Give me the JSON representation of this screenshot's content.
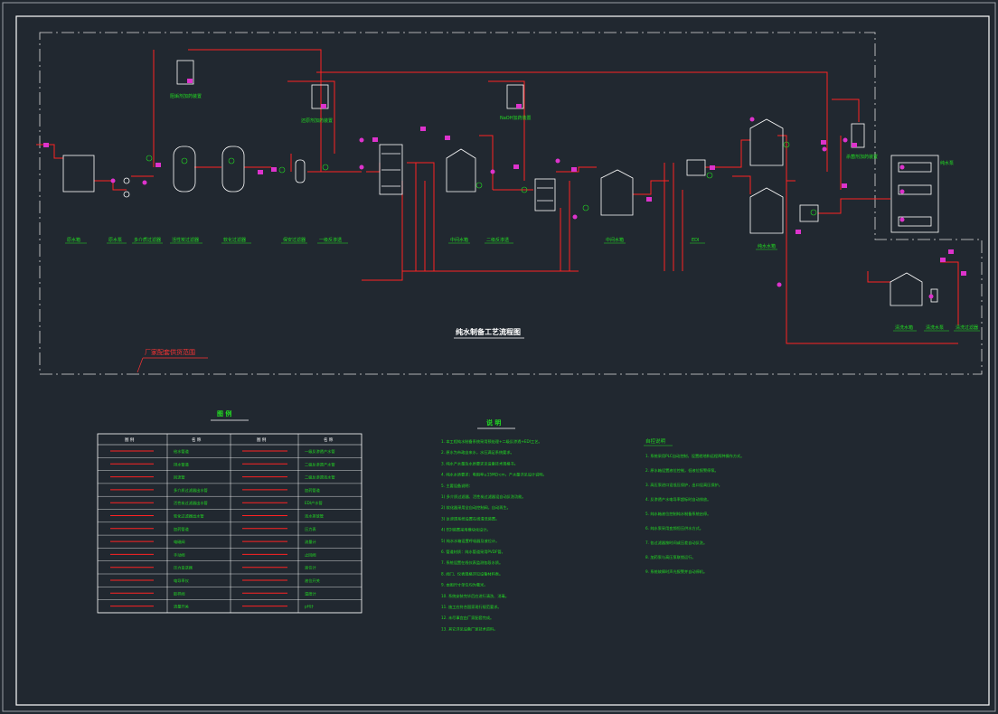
{
  "drawing": {
    "title": "纯水制备工艺流程图",
    "scope_label": "厂家配套供货范围",
    "legend_title": "图 例",
    "notes_title": "说 明",
    "control_title": "自控说明"
  },
  "equipment_labels": [
    "原水箱",
    "原水泵",
    "多介质过滤器",
    "活性炭过滤器",
    "软化过滤器",
    "保安过滤器",
    "一级反渗透",
    "中间水箱",
    "二级反渗透",
    "中间水箱",
    "EDI",
    "纯水水箱",
    "纯水泵",
    "阻垢剂加药装置",
    "还原剂加药装置",
    "NaOH加药装置",
    "杀菌剂加药装置",
    "清洗水箱",
    "清洗水泵",
    "清洗过滤器"
  ],
  "legend": {
    "headers": [
      "图 例",
      "名 称",
      "图 例",
      "名 称"
    ],
    "rows": [
      [
        "给水管道",
        "一级反渗透产水管"
      ],
      [
        "排水管道",
        "二级反渗透产水管"
      ],
      [
        "回流管",
        "二级反渗透浓水管"
      ],
      [
        "多介质过滤器出水管",
        "加药管道"
      ],
      [
        "活性炭过滤器出水管",
        "EDI产水管"
      ],
      [
        "软化过滤器出水管",
        "浓水排放管"
      ],
      [
        "加药管道",
        "压力表"
      ],
      [
        "电磁阀",
        "流量计"
      ],
      [
        "手动阀",
        "止回阀"
      ],
      [
        "压力变送器",
        "液位计"
      ],
      [
        "电导率仪",
        "液位开关"
      ],
      [
        "取样阀",
        "温度计"
      ],
      [
        "流量开关",
        "pH计"
      ]
    ]
  },
  "notes": [
    "1. 本工程纯水制备系统采用预处理+二级反渗透+EDI工艺。",
    "2. 原水为市政自来水，水压满足系统要求。",
    "3. 纯水产水量及水质要求见设备技术规格书。",
    "4. 纯水水质要求：电阻率≥15MΩ·cm，产水量详见设计说明。",
    "5. 主要设备说明：",
    "1) 多介质过滤器、活性炭过滤器设自动反洗功能。",
    "2) 软化器采用全自动控制阀，自动再生。",
    "3) 反渗透系统设置在线清洗装置。",
    "4) EDI装置采用模块化设计。",
    "5) 纯水水箱设置呼吸器及液位计。",
    "6. 管道材质：纯水管道采用PVDF管。",
    "7. 系统设置在线仪表监测各段水质。",
    "8. 阀门、仪表规格详见设备材料表。",
    "9. 本图尺寸单位均为毫米。",
    "10. 系统安装完毕后应进行清洗、消毒。",
    "11. 施工应符合国家现行规范要求。",
    "12. 未尽事宜由厂家配套完成。",
    "13. 其它详见设备厂家技术资料。"
  ],
  "control_notes": [
    "1. 系统采用PLC自动控制，设置就地和远程两种操作方式。",
    "2. 原水箱设置液位控制，低液位报警停泵。",
    "3. 高压泵进口设低压保护，出口设高压保护。",
    "4. 反渗透产水电导率超标时自动排放。",
    "5. 纯水箱液位控制纯水制备系统启停。",
    "6. 纯水泵采用变频恒压供水方式。",
    "7. 各过滤器按时间或压差自动反洗。",
    "8. 加药泵与高压泵联锁运行。",
    "9. 系统故障时声光报警并自动停机。"
  ],
  "colors": {
    "background": "#212830",
    "pipe_red": "#ff2222",
    "label_green": "#22dd22",
    "magenta": "#dd33cc",
    "white": "#ffffff",
    "cyan": "#33cccc"
  }
}
